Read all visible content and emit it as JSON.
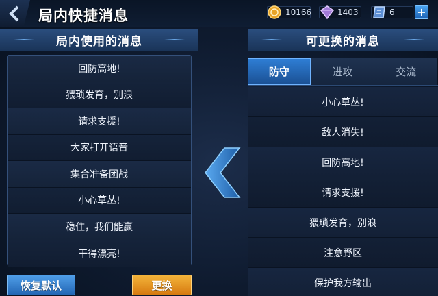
{
  "header": {
    "title": "局内快捷消息",
    "back_icon": "back-arrow-icon"
  },
  "resources": [
    {
      "icon": "gold-coin-icon",
      "value": "10166"
    },
    {
      "icon": "diamond-icon",
      "value": "1403"
    },
    {
      "icon": "voucher-icon",
      "value": "6"
    }
  ],
  "plus_label": "+",
  "left_panel": {
    "title": "局内使用的消息",
    "items": [
      "回防高地!",
      "猥琐发育，别浪",
      "请求支援!",
      "大家打开语音",
      "集合准备团战",
      "小心草丛!",
      "稳住，我们能赢",
      "干得漂亮!"
    ]
  },
  "right_panel": {
    "title": "可更换的消息",
    "tabs": [
      "防守",
      "进攻",
      "交流"
    ],
    "active_tab": 0,
    "items": [
      "小心草丛!",
      "敌人消失!",
      "回防高地!",
      "请求支援!",
      "猥琐发育，别浪",
      "注意野区",
      "保护我方输出"
    ]
  },
  "buttons": {
    "restore_label": "恢复默认",
    "replace_label": "更换"
  },
  "colors": {
    "accent_blue": "#2f7fd6",
    "accent_orange": "#e89a25",
    "panel_header": "#2a4d7d"
  }
}
